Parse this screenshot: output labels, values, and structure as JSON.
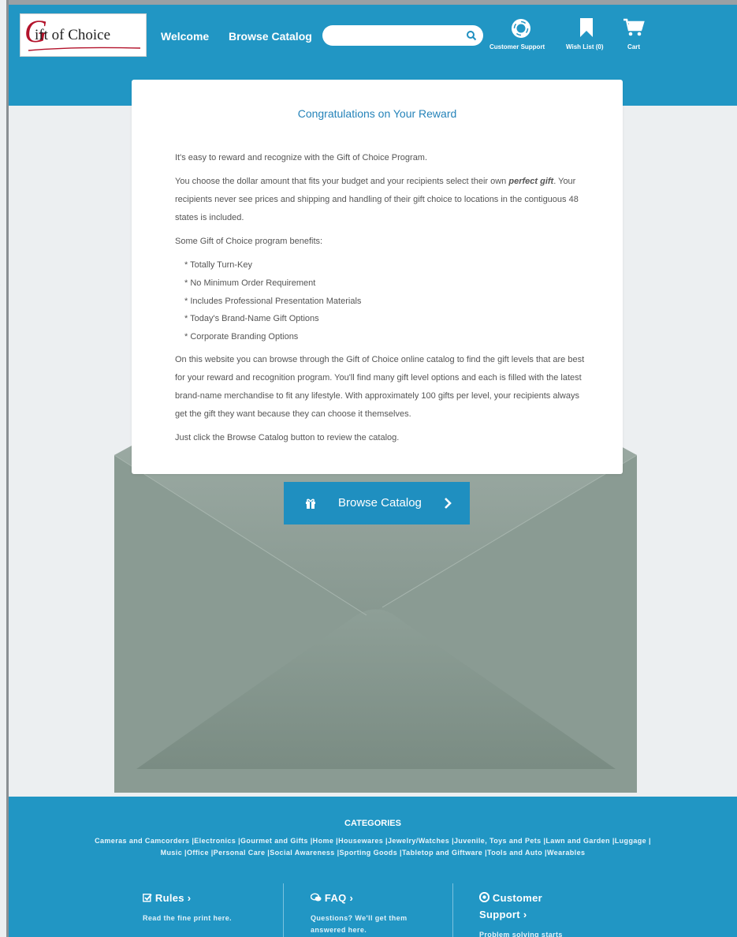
{
  "header": {
    "logo_alt": "Gift of Choice",
    "logo_g": "G",
    "logo_rest": "ift of Choice",
    "nav": {
      "welcome": "Welcome",
      "browse_catalog": "Browse Catalog"
    },
    "search": {
      "value": "",
      "placeholder": ""
    },
    "icons": [
      {
        "name": "lifebuoy-icon",
        "label": "Customer Support"
      },
      {
        "name": "bookmark-icon",
        "label": "Wish List (0)"
      },
      {
        "name": "cart-icon",
        "label": "Cart"
      }
    ]
  },
  "letter": {
    "title": "Congratulations on Your Reward",
    "p1": "It's easy to reward and recognize with the Gift of Choice Program.",
    "p2_pre": "You choose the dollar amount that fits your budget and your recipients select their own ",
    "p2_em": "perfect gift",
    "p2_post": ". Your recipients never see prices and shipping and handling of their gift choice to locations in the contiguous 48 states is included.",
    "p3": "Some Gift of Choice program benefits:",
    "benefits": [
      "* Totally Turn-Key",
      "* No Minimum Order Requirement",
      "* Includes Professional Presentation Materials",
      "* Today's Brand-Name Gift Options",
      "* Corporate Branding Options"
    ],
    "p4": "On this website you can browse through the Gift of Choice online catalog to find the gift levels that are best for your reward and recognition program.  You'll find many gift level options and each is filled with the latest brand-name merchandise to fit any lifestyle. With approximately 100 gifts per level, your recipients always get the gift they want because they can choose it themselves.",
    "p5": "Just click the Browse Catalog button to review the catalog.",
    "button_label": "Browse Catalog"
  },
  "footer": {
    "categories_title": "CATEGORIES",
    "categories": [
      "Cameras and Camcorders",
      "Electronics",
      "Gourmet and Gifts",
      "Home",
      "Housewares",
      "Jewelry/Watches",
      "Juvenile, Toys and Pets",
      "Lawn and Garden",
      "Luggage",
      "Music",
      "Office",
      "Personal Care",
      "Social Awareness",
      "Sporting Goods",
      "Tabletop and Giftware",
      "Tools and Auto",
      "Wearables"
    ],
    "columns": [
      {
        "icon": "checkbox-icon",
        "title": "Rules ›",
        "sub": "Read the fine print here."
      },
      {
        "icon": "chat-bubbles-icon",
        "title": "FAQ ›",
        "sub": "Questions? We'll get them answered here."
      },
      {
        "icon": "lifebuoy-icon",
        "title": "Customer Support ›",
        "sub": "Problem solving starts"
      }
    ]
  },
  "colors": {
    "brand_blue": "#2196c4",
    "button_blue": "#1f8fc0",
    "title_blue": "#2583b9",
    "envelope": "#87988f",
    "logo_red": "#b3132b"
  }
}
